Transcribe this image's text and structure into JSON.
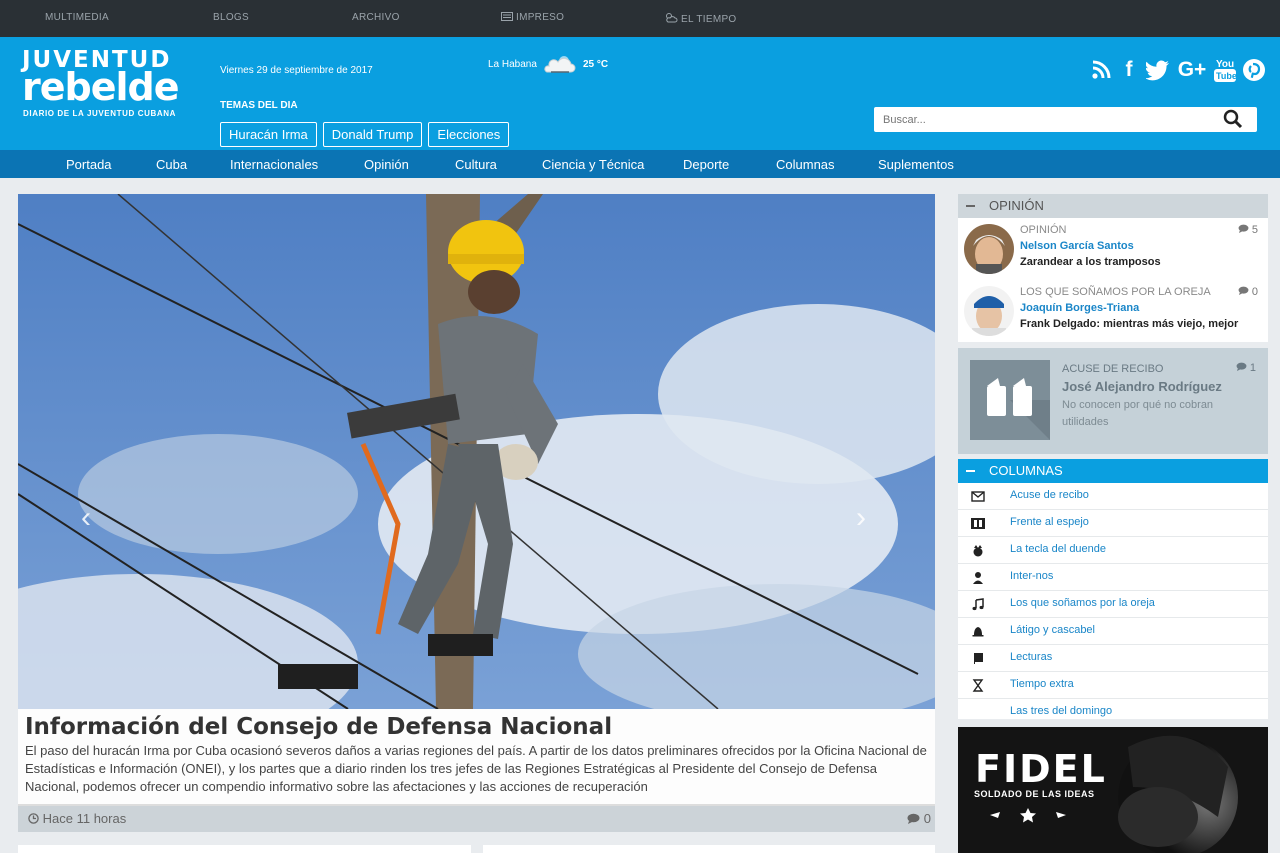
{
  "topbar": {
    "items": [
      "MULTIMEDIA",
      "BLOGS",
      "ARCHIVO",
      "IMPRESO",
      "EL TIEMPO"
    ]
  },
  "header": {
    "logo_line1": "JUVENTUD",
    "logo_line2": "rebelde",
    "logo_tagline": "DIARIO DE LA JUVENTUD CUBANA",
    "date": "Viernes 29 de septiembre de 2017",
    "weather_city": "La Habana",
    "weather_temp": "25 °C",
    "temas_label": "TEMAS DEL DIA",
    "temas": [
      "Huracán Irma",
      "Donald Trump",
      "Elecciones"
    ],
    "search_placeholder": "Buscar..."
  },
  "nav": {
    "items": [
      "Portada",
      "Cuba",
      "Internacionales",
      "Opinión",
      "Cultura",
      "Ciencia y Técnica",
      "Deporte",
      "Columnas",
      "Suplementos"
    ]
  },
  "featured": {
    "title": "Información del Consejo de Defensa Nacional",
    "summary": "El paso del huracán Irma por Cuba ocasionó severos daños a varias regiones del país. A partir de los datos preliminares ofrecidos por la Oficina Nacional de Estadísticas e Información (ONEI), y los partes que a diario rinden los tres jefes de las Regiones Estratégicas al Presidente del Consejo de Defensa Nacional, podemos ofrecer un compendio informativo sobre las afectaciones y las acciones de recuperación",
    "time": "Hace 11 horas",
    "comments": "0"
  },
  "opinion": {
    "heading": "OPINIÓN",
    "items": [
      {
        "category": "OPINIÓN",
        "author": "Nelson García Santos",
        "title": "Zarandear a los tramposos",
        "comments": "5"
      },
      {
        "category": "LOS QUE SOÑAMOS POR LA OREJA",
        "author": "Joaquín Borges-Triana",
        "title": "Frank Delgado: mientras más viejo, mejor",
        "comments": "0"
      }
    ]
  },
  "acuse": {
    "category": "ACUSE DE RECIBO",
    "author": "José Alejandro Rodríguez",
    "description": "No conocen por qué no cobran utilidades",
    "comments": "1"
  },
  "columnas": {
    "heading": "COLUMNAS",
    "items": [
      {
        "label": "Acuse de recibo",
        "icon": "envelope-icon"
      },
      {
        "label": "Frente al espejo",
        "icon": "mirror-icon"
      },
      {
        "label": "La tecla del duende",
        "icon": "goblin-icon"
      },
      {
        "label": "Inter-nos",
        "icon": "person-icon"
      },
      {
        "label": "Los que soñamos por la oreja",
        "icon": "music-note-icon"
      },
      {
        "label": "Látigo y cascabel",
        "icon": "bell-icon"
      },
      {
        "label": "Lecturas",
        "icon": "book-icon"
      },
      {
        "label": "Tiempo extra",
        "icon": "hourglass-icon"
      },
      {
        "label": "Las tres del domingo",
        "icon": "three-icon"
      }
    ]
  },
  "banner": {
    "title": "FIDEL",
    "subtitle": "SOLDADO DE LAS IDEAS"
  },
  "colors": {
    "topbar": "#2a3035",
    "header": "#0a9fe0",
    "nav": "#0b74b4",
    "link": "#1a86c8"
  }
}
